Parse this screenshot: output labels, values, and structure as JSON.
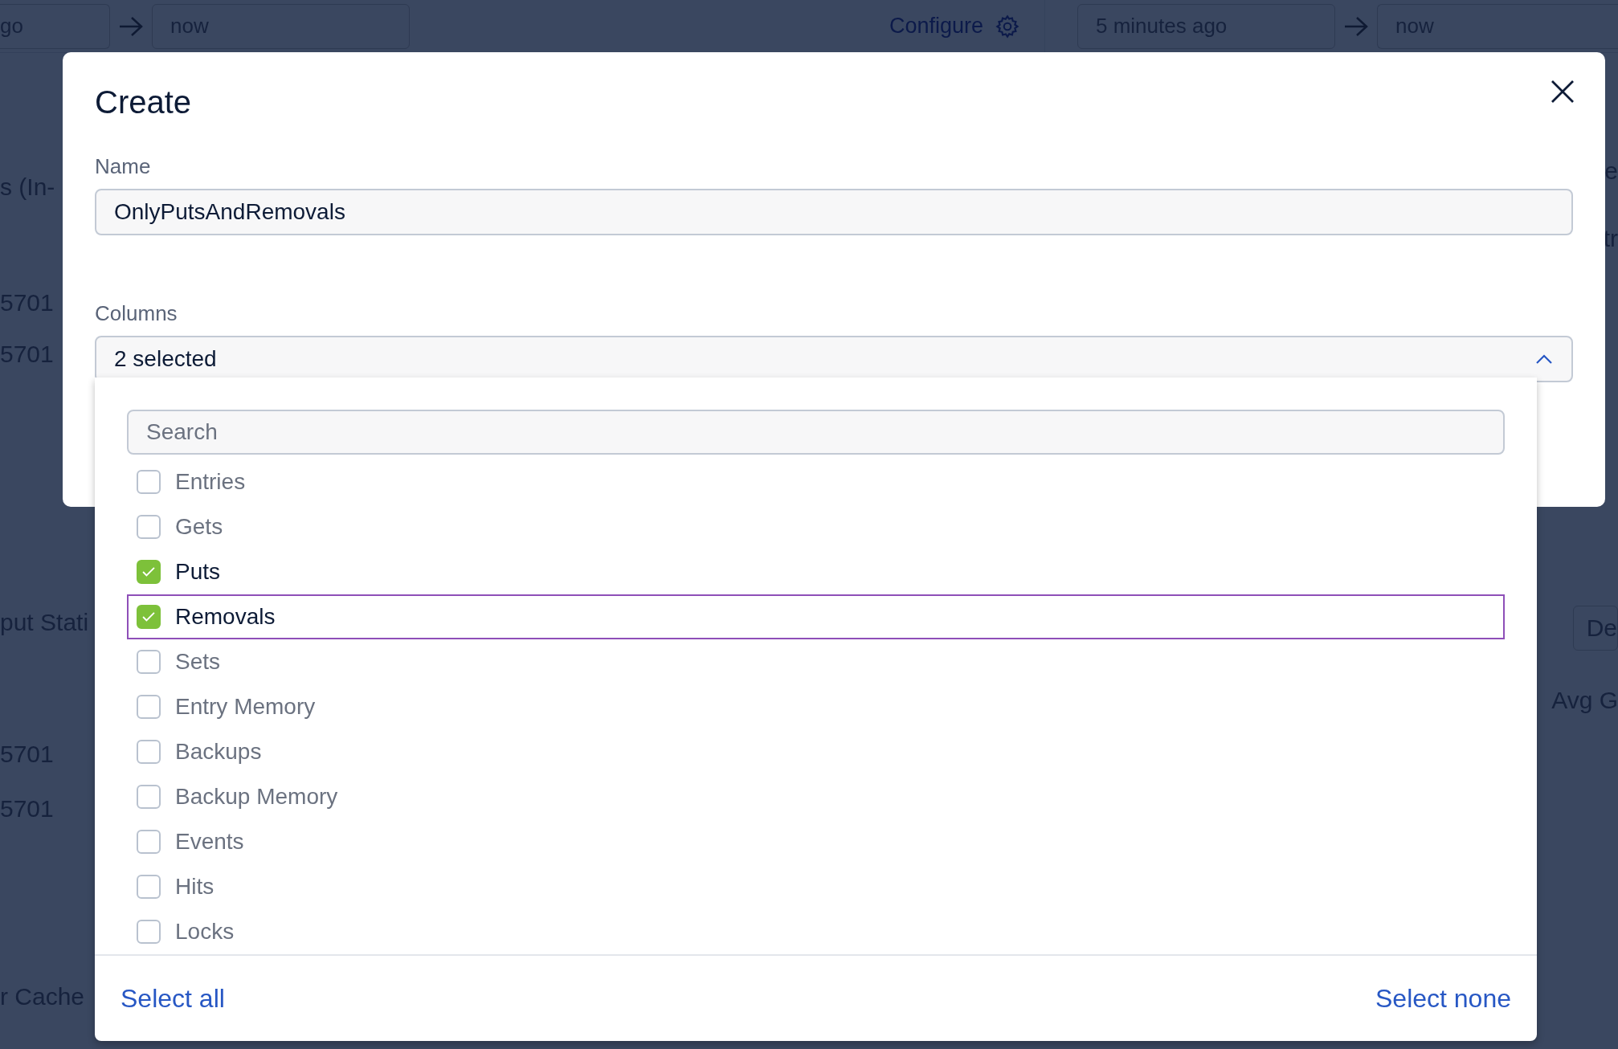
{
  "background": {
    "left_range": {
      "from": "go",
      "to": "now"
    },
    "configure": "Configure",
    "right_range": {
      "from": "5 minutes ago",
      "to": "now"
    },
    "left_texts": [
      "s (In-",
      "5701",
      "5701",
      "put Stati",
      "5701",
      "5701",
      "r Cache"
    ],
    "right_texts": [
      "e",
      "tr"
    ],
    "right_button": "De",
    "right_heading": "Avg G"
  },
  "dialog": {
    "title": "Create",
    "name_label": "Name",
    "name_value": "OnlyPutsAndRemovals",
    "columns_label": "Columns",
    "columns_value": "2 selected",
    "expanded": true,
    "dropdown": {
      "search_placeholder": "Search",
      "options": [
        {
          "label": "Entries",
          "checked": false,
          "focused": false
        },
        {
          "label": "Gets",
          "checked": false,
          "focused": false
        },
        {
          "label": "Puts",
          "checked": true,
          "focused": false
        },
        {
          "label": "Removals",
          "checked": true,
          "focused": true
        },
        {
          "label": "Sets",
          "checked": false,
          "focused": false
        },
        {
          "label": "Entry Memory",
          "checked": false,
          "focused": false
        },
        {
          "label": "Backups",
          "checked": false,
          "focused": false
        },
        {
          "label": "Backup Memory",
          "checked": false,
          "focused": false
        },
        {
          "label": "Events",
          "checked": false,
          "focused": false
        },
        {
          "label": "Hits",
          "checked": false,
          "focused": false
        },
        {
          "label": "Locks",
          "checked": false,
          "focused": false
        }
      ],
      "select_all": "Select all",
      "select_none": "Select none"
    }
  }
}
